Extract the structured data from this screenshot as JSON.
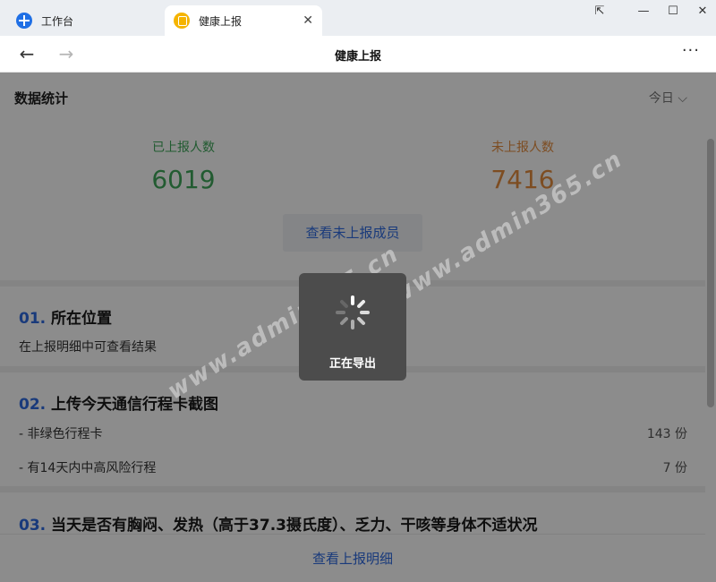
{
  "tabs": [
    {
      "label": "工作台",
      "icon": "workbench-icon"
    },
    {
      "label": "健康上报",
      "icon": "health-report-icon"
    }
  ],
  "window_controls": {
    "restore": "⇱",
    "minimize": "—",
    "maximize": "☐",
    "close": "✕"
  },
  "nav": {
    "title": "健康上报",
    "back": "←",
    "forward": "→",
    "more": "···"
  },
  "stats": {
    "title": "数据统计",
    "period": "今日",
    "reported_label": "已上报人数",
    "reported_value": "6019",
    "unreported_label": "未上报人数",
    "unreported_value": "7416",
    "view_unreported": "查看未上报成员"
  },
  "sections": [
    {
      "num": "01.",
      "title": "所在位置",
      "text": "在上报明细中可查看结果"
    },
    {
      "num": "02.",
      "title": "上传今天通信行程卡截图",
      "items": [
        {
          "label": "- 非绿色行程卡",
          "count": "143 份"
        },
        {
          "label": "- 有14天内中高风险行程",
          "count": "7 份"
        }
      ]
    },
    {
      "num": "03.",
      "title": "当天是否有胸闷、发热（高于37.3摄氏度）、乏力、干咳等身体不适状况"
    }
  ],
  "footer": {
    "view_details": "查看上报明细"
  },
  "toast": {
    "text": "正在导出"
  },
  "watermark": "www.admin365.cn",
  "colors": {
    "accent": "#2f6ae0",
    "reported": "#3ea75a",
    "unreported": "#e48c3e"
  }
}
